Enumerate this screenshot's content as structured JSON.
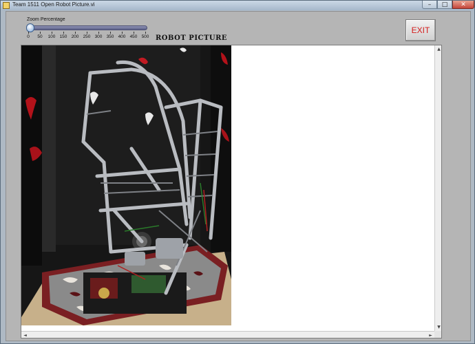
{
  "window": {
    "title": "Team 1511 Open Robot Picture.vi",
    "minimize": "–",
    "maximize": "□",
    "close": "✕"
  },
  "zoom": {
    "label": "Zoom Percentage",
    "ticks": [
      "0",
      "50",
      "100",
      "150",
      "200",
      "250",
      "300",
      "350",
      "400",
      "450",
      "500"
    ],
    "min": 0,
    "max": 500,
    "value": 0
  },
  "picture": {
    "title": "ROBOT PICTURE",
    "content_icon": "robot-photo"
  },
  "exit_button": {
    "label": "EXIT",
    "color": "#d41a1a"
  },
  "scrollbars": {
    "up": "▲",
    "down": "▼",
    "left": "◄",
    "right": "►"
  }
}
